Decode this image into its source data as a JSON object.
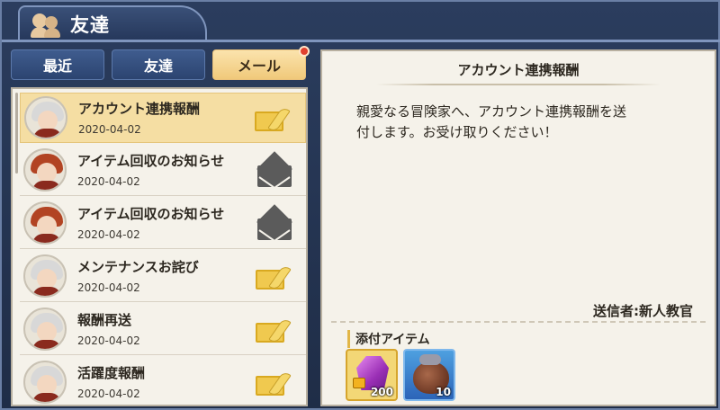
{
  "header": {
    "title": "友達"
  },
  "tabs": [
    {
      "label": "最近",
      "active": false
    },
    {
      "label": "友達",
      "active": false
    },
    {
      "label": "メール",
      "active": true
    }
  ],
  "mail_list": [
    {
      "title": "アカウント連携報酬",
      "date": "2020-04-02",
      "avatar": "white",
      "status": "read-icon",
      "selected": true
    },
    {
      "title": "アイテム回収のお知らせ",
      "date": "2020-04-02",
      "avatar": "red",
      "status": "unread-icon",
      "selected": false
    },
    {
      "title": "アイテム回収のお知らせ",
      "date": "2020-04-02",
      "avatar": "red",
      "status": "unread-icon",
      "selected": false
    },
    {
      "title": "メンテナンスお詫び",
      "date": "2020-04-02",
      "avatar": "white",
      "status": "read-icon",
      "selected": false
    },
    {
      "title": "報酬再送",
      "date": "2020-04-02",
      "avatar": "white",
      "status": "read-icon",
      "selected": false
    },
    {
      "title": "活躍度報酬",
      "date": "2020-04-02",
      "avatar": "white",
      "status": "read-icon",
      "selected": false
    }
  ],
  "detail": {
    "title": "アカウント連携報酬",
    "body_line1": "親愛なる冒険家へ、アカウント連携報酬を送",
    "body_line2": "付します。お受け取りください！",
    "sender": "送信者:新人教官",
    "attach_label": "添付アイテム",
    "attachments": [
      {
        "icon": "purple-gem-icon",
        "qty": "200",
        "frame": "gold"
      },
      {
        "icon": "pouch-icon",
        "qty": "10",
        "frame": "blue"
      }
    ]
  },
  "colors": {
    "active_tab": "#f0c97a",
    "tab": "#3f5c8e",
    "badge": "#e0402e",
    "panel_bg": "#f5f2ea",
    "selected_row": "#f5dea3"
  }
}
